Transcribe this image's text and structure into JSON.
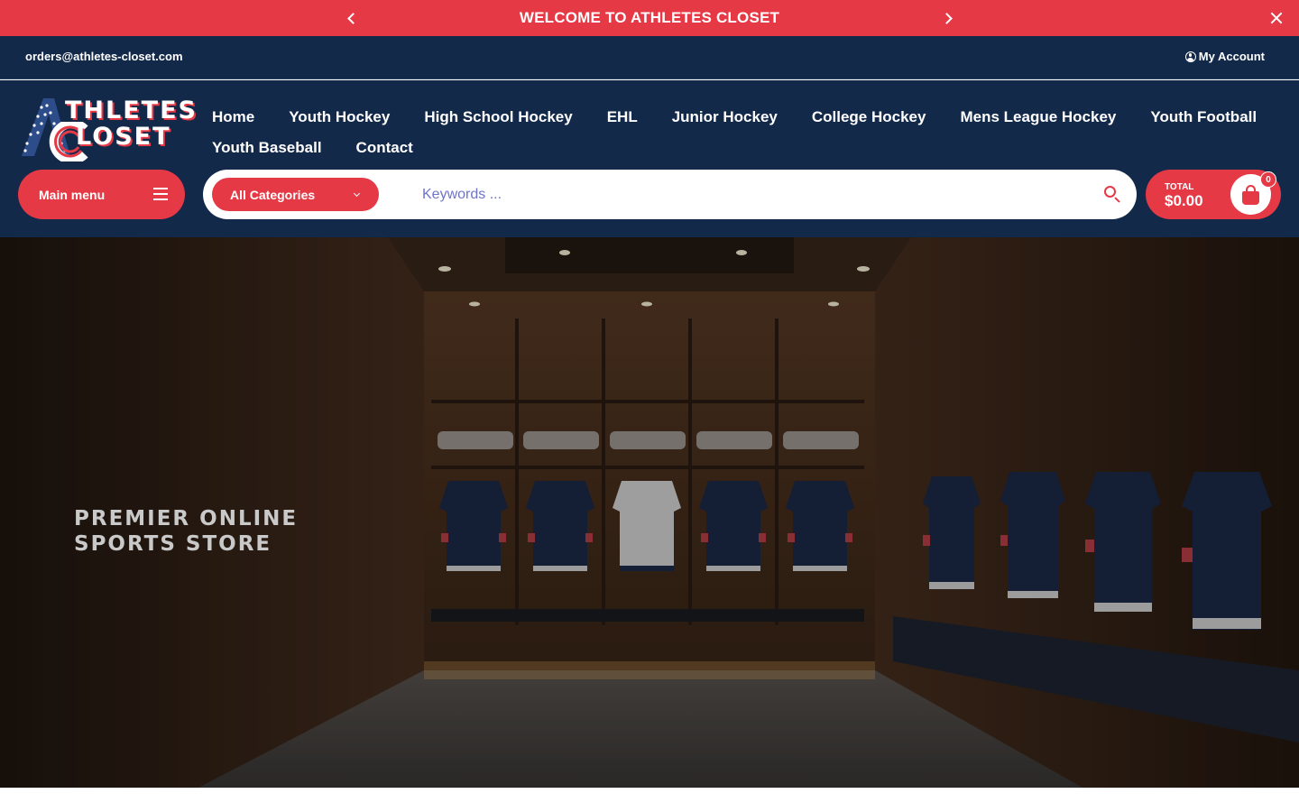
{
  "announcement": {
    "text": "WELCOME TO ATHLETES CLOSET",
    "prev_icon": "chevron-left-icon",
    "next_icon": "chevron-right-icon",
    "close_icon": "close-icon"
  },
  "utility": {
    "email": "orders@athletes-closet.com",
    "account_label": "My Account",
    "account_icon": "user-circle-icon"
  },
  "logo": {
    "line1": "THLETES",
    "line2": "LOSET"
  },
  "nav": {
    "row1": [
      "Home",
      "Youth Hockey",
      "High School Hockey",
      "EHL",
      "Junior Hockey",
      "College Hockey",
      "Mens League Hockey",
      "Youth Football"
    ],
    "row2": [
      "Youth Baseball",
      "Contact"
    ]
  },
  "main_menu": {
    "label": "Main menu",
    "icon": "hamburger-icon"
  },
  "search": {
    "category_label": "All Categories",
    "placeholder": "Keywords ...",
    "value": "",
    "icon": "search-icon"
  },
  "cart": {
    "total_label": "TOTAL",
    "total_value": "$0.00",
    "count": "0",
    "icon": "shopping-bag-icon"
  },
  "hero": {
    "heading_line1": "PREMIER ONLINE",
    "heading_line2": "SPORTS STORE"
  },
  "colors": {
    "accent": "#e63946",
    "navy": "#13294a"
  }
}
